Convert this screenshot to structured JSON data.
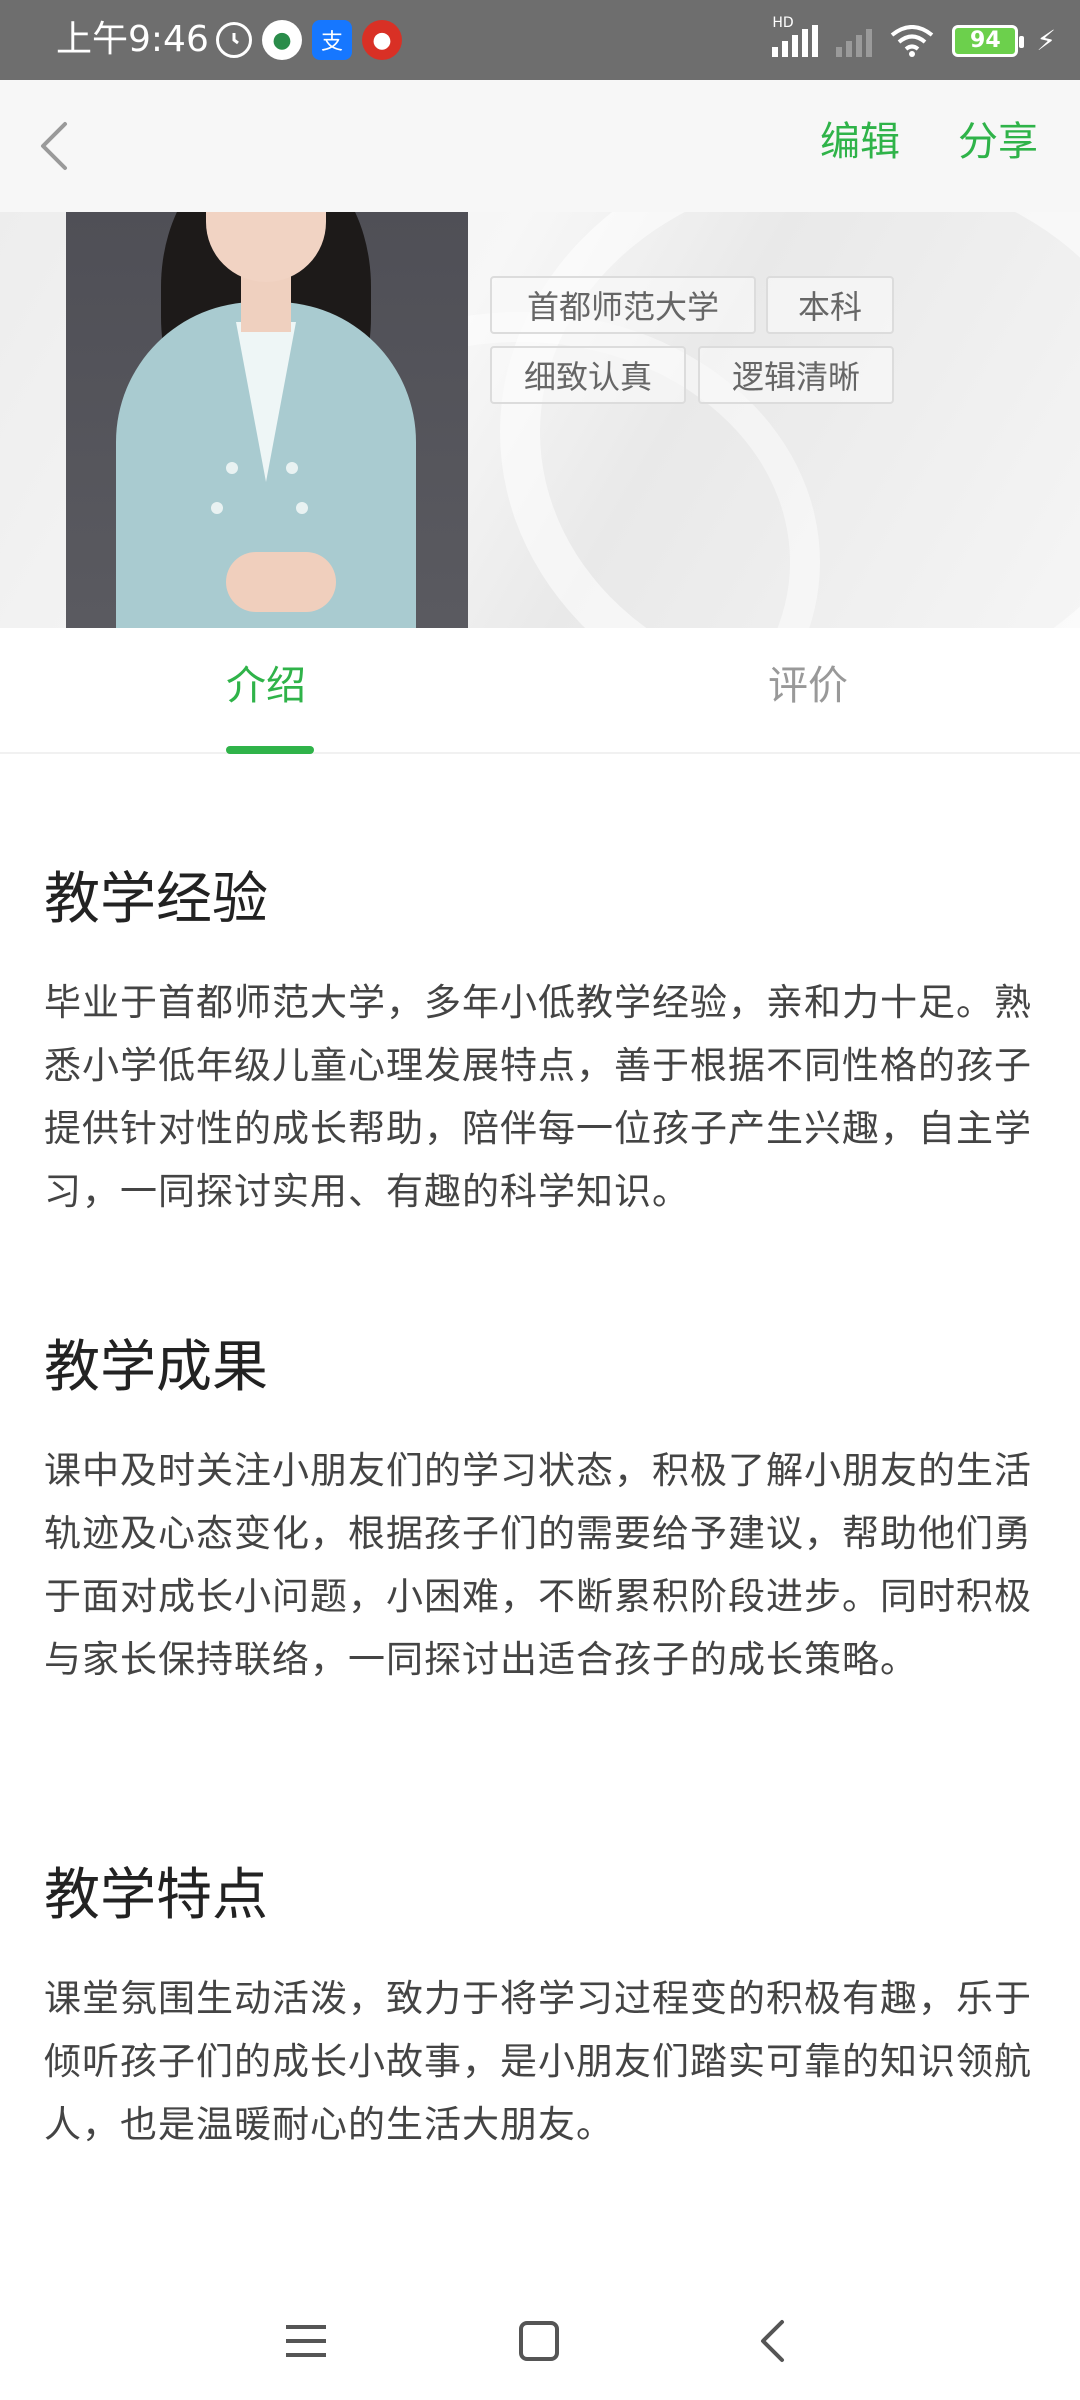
{
  "status_bar": {
    "time": "上午9:46",
    "battery": "94",
    "signal_label": "HD"
  },
  "header": {
    "edit_label": "编辑",
    "share_label": "分享"
  },
  "profile": {
    "tags": [
      "首都师范大学",
      "本科",
      "细致认真",
      "逻辑清晰"
    ]
  },
  "tabs": [
    {
      "label": "介绍",
      "active": true
    },
    {
      "label": "评价",
      "active": false
    }
  ],
  "sections": [
    {
      "title": "教学经验",
      "body": "毕业于首都师范大学，多年小低教学经验，亲和力十足。熟悉小学低年级儿童心理发展特点，善于根据不同性格的孩子提供针对性的成长帮助，陪伴每一位孩子产生兴趣，自主学习，一同探讨实用、有趣的科学知识。"
    },
    {
      "title": "教学成果",
      "body": "课中及时关注小朋友们的学习状态，积极了解小朋友的生活轨迹及心态变化，根据孩子们的需要给予建议，帮助他们勇于面对成长小问题，小困难，不断累积阶段进步。同时积极与家长保持联络，一同探讨出适合孩子的成长策略。"
    },
    {
      "title": "教学特点",
      "body": "课堂氛围生动活泼，致力于将学习过程变的积极有趣，乐于倾听孩子们的成长小故事，是小朋友们踏实可靠的知识领航人，也是温暖耐心的生活大朋友。"
    }
  ],
  "colors": {
    "accent": "#2fb349",
    "status_bar": "#6e6e6e"
  },
  "icons": {
    "back": "chevron-left-icon",
    "nav_menu": "menu-icon",
    "nav_home": "home-square-icon",
    "nav_back": "back-chevron-icon"
  }
}
